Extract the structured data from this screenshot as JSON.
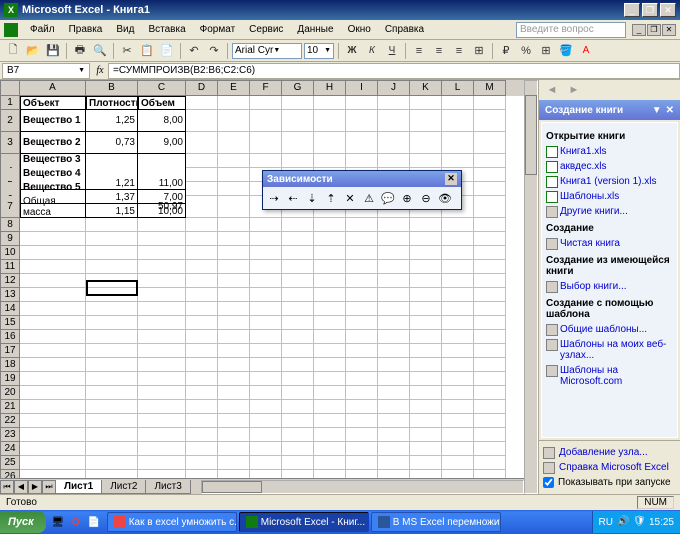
{
  "title": "Microsoft Excel - Книга1",
  "menu": [
    "Файл",
    "Правка",
    "Вид",
    "Вставка",
    "Формат",
    "Сервис",
    "Данные",
    "Окно",
    "Справка"
  ],
  "question_placeholder": "Введите вопрос",
  "font": {
    "name": "Arial Cyr",
    "size": "10"
  },
  "name_box": "B7",
  "formula": "=СУММПРОИЗВ(B2:B6;C2:C6)",
  "columns": [
    "A",
    "B",
    "C",
    "D",
    "E",
    "F",
    "G",
    "H",
    "I",
    "J",
    "K",
    "L",
    "M"
  ],
  "chart_data": {
    "type": "table",
    "headers": [
      "Объект",
      "Плотность",
      "Объем"
    ],
    "rows": [
      {
        "label": "Вещество 1",
        "density": "1,25",
        "volume": "8,00"
      },
      {
        "label": "Вещество 2",
        "density": "0,73",
        "volume": "9,00"
      },
      {
        "label": "Вещество 3",
        "density": "",
        "volume": ""
      },
      {
        "label": "",
        "density": "1,21",
        "volume": "11,00"
      },
      {
        "label": "Вещество 4",
        "density": "",
        "volume": ""
      },
      {
        "label": "",
        "density": "1,37",
        "volume": "7,00"
      },
      {
        "label": "Вещество 5",
        "density": "",
        "volume": ""
      },
      {
        "label": "",
        "density": "1,15",
        "volume": "10,00"
      }
    ],
    "total_label": "Общая масса",
    "total_value": "50,97"
  },
  "sheets": [
    "Лист1",
    "Лист2",
    "Лист3"
  ],
  "active_sheet": 0,
  "float_toolbar": {
    "title": "Зависимости"
  },
  "taskpane": {
    "title": "Создание книги",
    "open_title": "Открытие книги",
    "open_items": [
      "Книга1.xls",
      "аквдес.xls",
      "Книга1 (version 1).xls",
      "Шаблоны.xls"
    ],
    "open_more": "Другие книги...",
    "create_title": "Создание",
    "create_blank": "Чистая книга",
    "from_existing_title": "Создание из имеющейся книги",
    "from_existing": "Выбор книги...",
    "from_template_title": "Создание с помощью шаблона",
    "template_items": [
      "Общие шаблоны...",
      "Шаблоны на моих веб-узлах...",
      "Шаблоны на Microsoft.com"
    ],
    "footer_add": "Добавление узла...",
    "footer_help": "Справка Microsoft Excel",
    "footer_show": "Показывать при запуске"
  },
  "status": "Готово",
  "status_num": "NUM",
  "taskbar": {
    "start": "Пуск",
    "tasks": [
      {
        "label": "Как в excel умножить с...",
        "active": false,
        "type": "browser"
      },
      {
        "label": "Microsoft Excel - Книг...",
        "active": true,
        "type": "excel"
      },
      {
        "label": "В MS Excel перемножит...",
        "active": false,
        "type": "word"
      }
    ],
    "lang": "RU",
    "clock": "15:25"
  }
}
